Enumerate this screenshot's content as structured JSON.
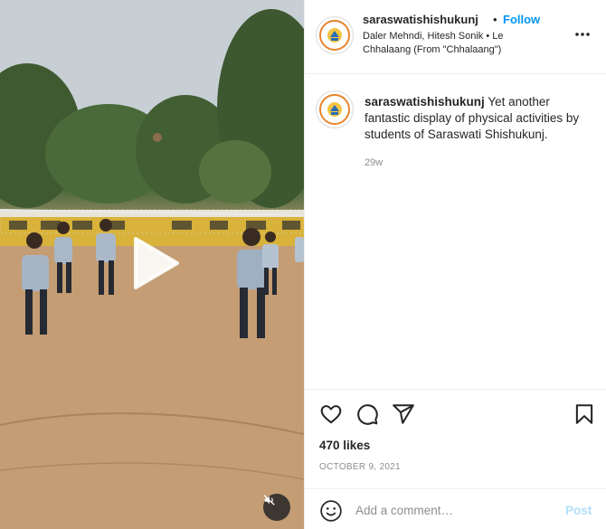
{
  "post": {
    "username": "saraswatishishukunj",
    "separator": "•",
    "follow_label": "Follow",
    "audio": "Daler Mehndi, Hitesh Sonik • Le Chhalaang (From \"Chhalaang\")",
    "more_icon": "more-options-icon",
    "caption_user": "saraswatishishukunj",
    "caption_text": "Yet another fantastic display of physical activities by students of Saraswati Shishukunj.",
    "age": "29w",
    "likes": "470 likes",
    "date": "OCTOBER 9, 2021"
  },
  "actions": {
    "like_icon": "heart-icon",
    "comment_icon": "comment-icon",
    "share_icon": "share-icon",
    "save_icon": "bookmark-icon"
  },
  "comment": {
    "placeholder": "Add a comment…",
    "post_label": "Post",
    "emoji_icon": "emoji-icon"
  },
  "media": {
    "play_icon": "play-icon",
    "mute_icon": "muted-speaker-icon"
  },
  "colors": {
    "link": "#0095f6",
    "post_disabled": "#b2dffc",
    "avatar_ring": "#e8842c"
  }
}
